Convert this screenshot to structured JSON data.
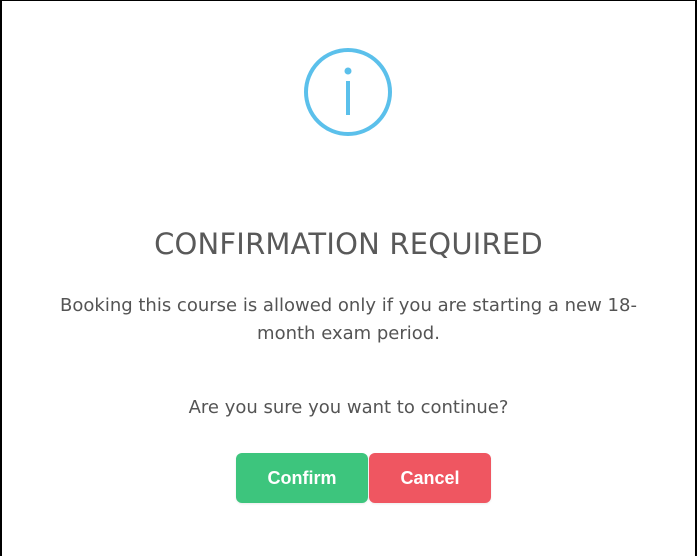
{
  "dialog": {
    "icon": "info-icon",
    "title": "CONFIRMATION REQUIRED",
    "message": "Booking this course is allowed only if you are starting a new 18-month exam period.",
    "question": "Are you sure you want to continue?",
    "confirm_label": "Confirm",
    "cancel_label": "Cancel"
  },
  "colors": {
    "icon": "#5bc0eb",
    "title": "#595959",
    "text": "#545454",
    "confirm": "#3dc57d",
    "cancel": "#ef5661"
  }
}
